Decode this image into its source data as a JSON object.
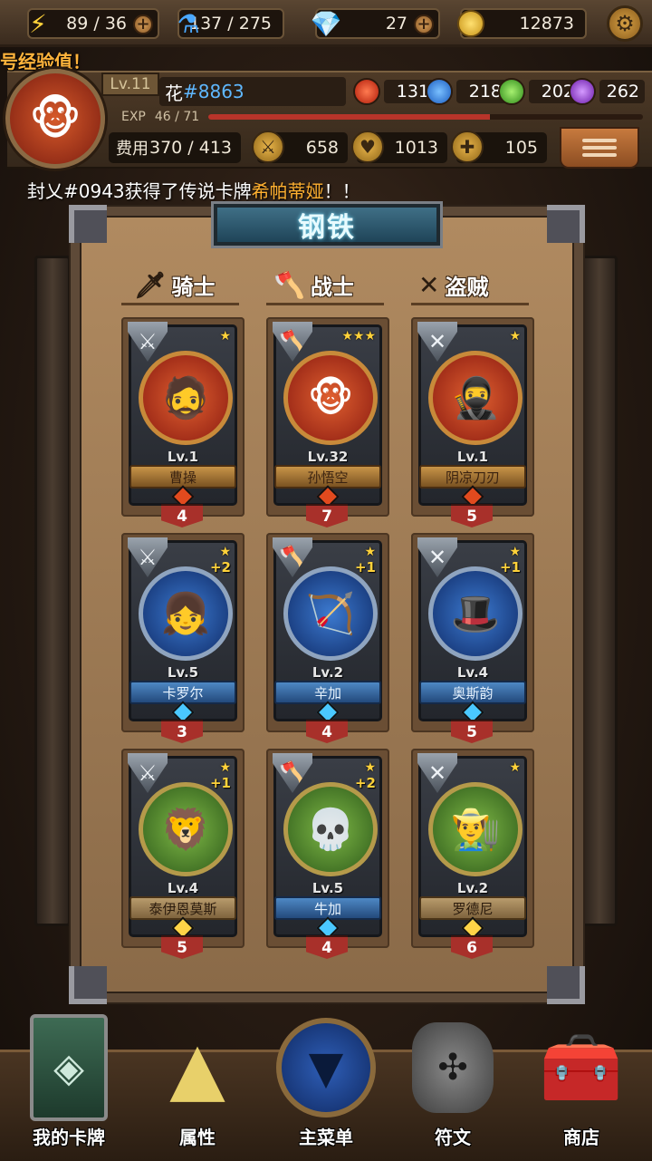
{
  "resources": {
    "energy": {
      "icon": "lightning-icon",
      "value": "89 / 36"
    },
    "potion": {
      "icon": "potion-icon",
      "value": "137 / 275"
    },
    "diamond": {
      "icon": "diamond-icon",
      "value": "27"
    },
    "gold": {
      "icon": "gold-coin-icon",
      "value": "12873"
    }
  },
  "player": {
    "xp_banner": "号经验值！",
    "level": "Lv.11",
    "name_prefix": "花",
    "name_tag": "#8863",
    "exp_label": "EXP",
    "exp_value": "46 / 71",
    "exp_fraction": 0.648,
    "cost_label": "费用",
    "cost_value": "370 / 413",
    "attack": "658",
    "health": "1013",
    "heal": "105",
    "orbs": [
      {
        "color": "#e0391e",
        "value": "131"
      },
      {
        "color": "#3a86e0",
        "value": "218"
      },
      {
        "color": "#5cc23a",
        "value": "202"
      },
      {
        "color": "#9b3ad6",
        "value": "262"
      }
    ]
  },
  "announcement": {
    "prefix": "封乂#0943获得了传说卡牌",
    "highlight": "希帕蒂娅",
    "suffix": "！！"
  },
  "deck": {
    "title": "钢铁",
    "classes": [
      {
        "name": "骑士",
        "icon": "sword-icon"
      },
      {
        "name": "战士",
        "icon": "axe-icon"
      },
      {
        "name": "盗贼",
        "icon": "crossed-daggers-icon"
      }
    ],
    "cards": [
      {
        "level": "Lv.1",
        "name": "曹操",
        "stars": "★",
        "plus": "",
        "cost": "4",
        "bg": "red",
        "plate": "gold",
        "gem": "red",
        "emoji": "🧔",
        "shield": "⚔"
      },
      {
        "level": "Lv.32",
        "name": "孙悟空",
        "stars": "★★★",
        "plus": "",
        "cost": "7",
        "bg": "red",
        "plate": "gold",
        "gem": "red",
        "emoji": "🐵",
        "shield": "🪓"
      },
      {
        "level": "Lv.1",
        "name": "阴凉刀刃",
        "stars": "★",
        "plus": "",
        "cost": "5",
        "bg": "red",
        "plate": "gold",
        "gem": "red",
        "emoji": "🥷",
        "shield": "✕"
      },
      {
        "level": "Lv.5",
        "name": "卡罗尔",
        "stars": "★",
        "plus": "+2",
        "cost": "3",
        "bg": "blue",
        "plate": "blue",
        "gem": "blue",
        "emoji": "👧",
        "shield": "⚔"
      },
      {
        "level": "Lv.2",
        "name": "辛加",
        "stars": "★",
        "plus": "+1",
        "cost": "4",
        "bg": "blue",
        "plate": "blue",
        "gem": "blue",
        "emoji": "🏹",
        "shield": "🪓"
      },
      {
        "level": "Lv.4",
        "name": "奥斯韵",
        "stars": "★",
        "plus": "+1",
        "cost": "5",
        "bg": "blue",
        "plate": "blue",
        "gem": "blue",
        "emoji": "🎩",
        "shield": "✕"
      },
      {
        "level": "Lv.4",
        "name": "泰伊恩莫斯",
        "stars": "★",
        "plus": "+1",
        "cost": "5",
        "bg": "green",
        "plate": "beige",
        "gem": "gold",
        "emoji": "🦁",
        "shield": "⚔"
      },
      {
        "level": "Lv.5",
        "name": "牛加",
        "stars": "★",
        "plus": "+2",
        "cost": "4",
        "bg": "green",
        "plate": "blue",
        "gem": "blue",
        "emoji": "💀",
        "shield": "🪓"
      },
      {
        "level": "Lv.2",
        "name": "罗德尼",
        "stars": "★",
        "plus": "",
        "cost": "6",
        "bg": "green",
        "plate": "beige",
        "gem": "gold",
        "emoji": "👨‍🌾",
        "shield": "✕"
      }
    ]
  },
  "nav": [
    {
      "label": "我的卡牌",
      "icon": "cards-icon"
    },
    {
      "label": "属性",
      "icon": "triangle-crystal-icon"
    },
    {
      "label": "主菜单",
      "icon": "main-menu-emblem-icon"
    },
    {
      "label": "符文",
      "icon": "rune-stone-icon"
    },
    {
      "label": "商店",
      "icon": "treasure-chest-icon"
    }
  ]
}
